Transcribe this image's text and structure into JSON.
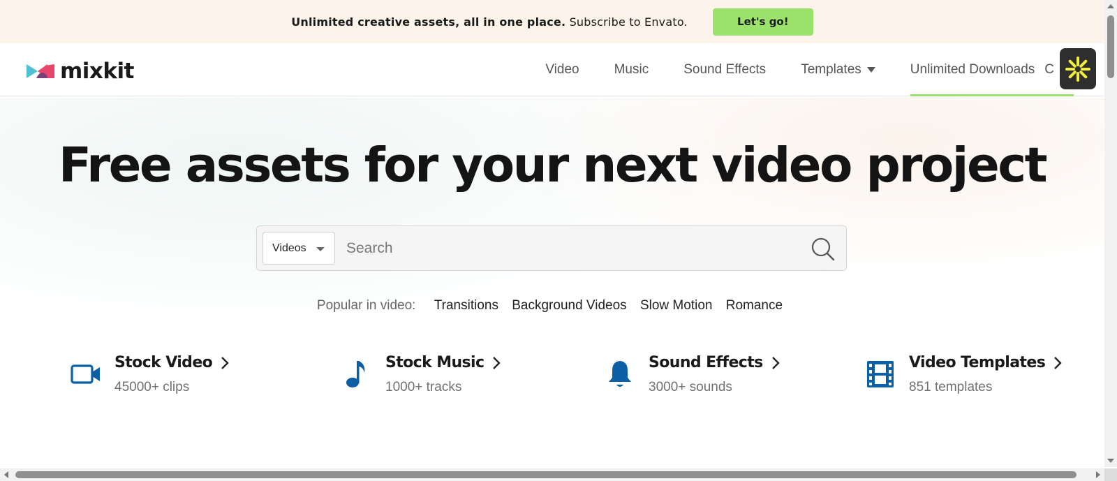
{
  "promo": {
    "bold_text": "Unlimited creative assets, all in one place.",
    "text": "Subscribe to Envato.",
    "button_label": "Let's go!"
  },
  "brand": {
    "name": "mixkit"
  },
  "nav": {
    "items": [
      {
        "label": "Video"
      },
      {
        "label": "Music"
      },
      {
        "label": "Sound Effects"
      },
      {
        "label": "Templates"
      },
      {
        "label": "Unlimited Downloads"
      }
    ],
    "cut_off_label": "C"
  },
  "hero": {
    "headline": "Free assets for your next video project"
  },
  "search": {
    "type_selected": "Videos",
    "placeholder": "Search"
  },
  "popular": {
    "label": "Popular in video:",
    "tags": [
      "Transitions",
      "Background Videos",
      "Slow Motion",
      "Romance"
    ]
  },
  "categories": [
    {
      "title": "Stock Video",
      "subtitle": "45000+ clips",
      "icon": "video-camera-icon"
    },
    {
      "title": "Stock Music",
      "subtitle": "1000+ tracks",
      "icon": "music-note-icon"
    },
    {
      "title": "Sound Effects",
      "subtitle": "3000+ sounds",
      "icon": "bell-icon"
    },
    {
      "title": "Video Templates",
      "subtitle": "851 templates",
      "icon": "film-strip-icon"
    }
  ],
  "colors": {
    "accent_green": "#9be26a",
    "promo_bg": "#fcf3ea",
    "icon_blue": "#0a5fa5"
  }
}
